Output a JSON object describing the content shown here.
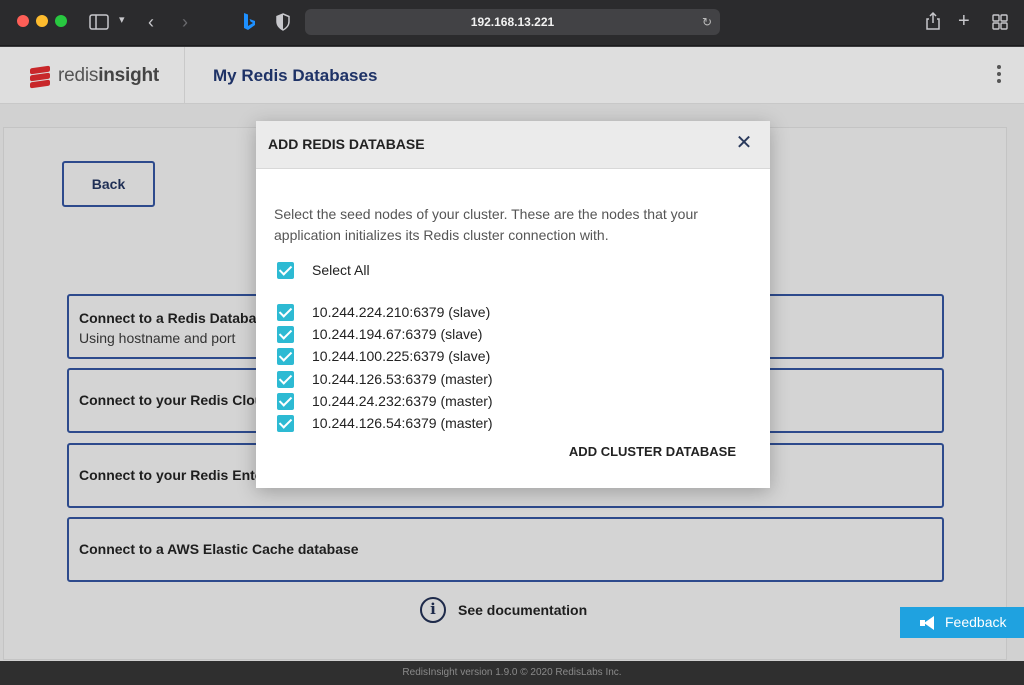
{
  "browser": {
    "address": "192.168.13.221"
  },
  "app": {
    "logo_light": "redis",
    "logo_bold": "insight",
    "page_title": "My Redis Databases",
    "back_label": "Back",
    "options": [
      {
        "title": "Connect to a Redis Database",
        "subtitle": "Using hostname and port"
      },
      {
        "title": "Connect to your Redis Cloud",
        "subtitle": ""
      },
      {
        "title": "Connect to your Redis Enterprise",
        "subtitle": ""
      },
      {
        "title": "Connect to a AWS Elastic Cache database",
        "subtitle": ""
      }
    ],
    "see_documentation": "See documentation",
    "footer": "RedisInsight version 1.9.0 © 2020 RedisLabs Inc.",
    "feedback": "Feedback"
  },
  "modal": {
    "title": "ADD REDIS DATABASE",
    "description": "Select the seed nodes of your cluster. These are the nodes that your application initializes its Redis cluster connection with.",
    "select_all": "Select All",
    "nodes": [
      "10.244.224.210:6379 (slave)",
      "10.244.194.67:6379 (slave)",
      "10.244.100.225:6379 (slave)",
      "10.244.126.53:6379 (master)",
      "10.244.24.232:6379 (master)",
      "10.244.126.54:6379 (master)"
    ],
    "submit": "ADD CLUSTER DATABASE"
  },
  "colors": {
    "accent_blue": "#2d4a8c",
    "checkbox_teal": "#2dbad3",
    "feedback_blue": "#1fa2e0",
    "logo_red": "#c8272a"
  },
  "icons": {
    "sidebar": "sidebar-icon",
    "back": "chevron-left-icon",
    "forward": "chevron-right-icon",
    "bing": "bing-icon",
    "shield": "shield-icon",
    "reload": "reload-icon",
    "share": "share-icon",
    "new_tab": "plus-icon",
    "tabs": "tab-overview-icon",
    "kebab": "kebab-menu-icon",
    "close": "close-icon",
    "info": "info-icon",
    "megaphone": "megaphone-icon"
  }
}
